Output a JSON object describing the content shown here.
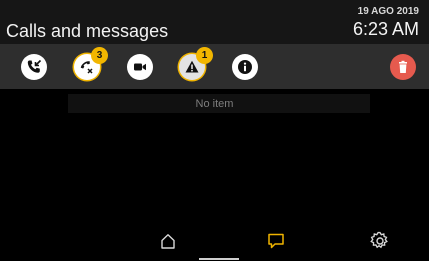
{
  "header": {
    "title": "Calls and messages",
    "date": "19 AGO 2019",
    "time": "6:23 AM"
  },
  "toolbar": {
    "items": [
      {
        "name": "incoming-calls-icon",
        "badge": ""
      },
      {
        "name": "missed-calls-icon",
        "badge": "3"
      },
      {
        "name": "video-messages-icon",
        "badge": ""
      },
      {
        "name": "alerts-icon",
        "badge": "1"
      },
      {
        "name": "info-icon",
        "badge": ""
      },
      {
        "name": "trash-icon",
        "badge": ""
      }
    ]
  },
  "content": {
    "empty_text": "No item"
  },
  "colors": {
    "badge": "#f2b600",
    "delete": "#e65a4e",
    "accent_active": "#f0b400"
  },
  "bottom_nav": {
    "items": [
      {
        "name": "home-icon",
        "active": false
      },
      {
        "name": "messages-icon",
        "active": true
      },
      {
        "name": "settings-icon",
        "active": false
      }
    ]
  }
}
